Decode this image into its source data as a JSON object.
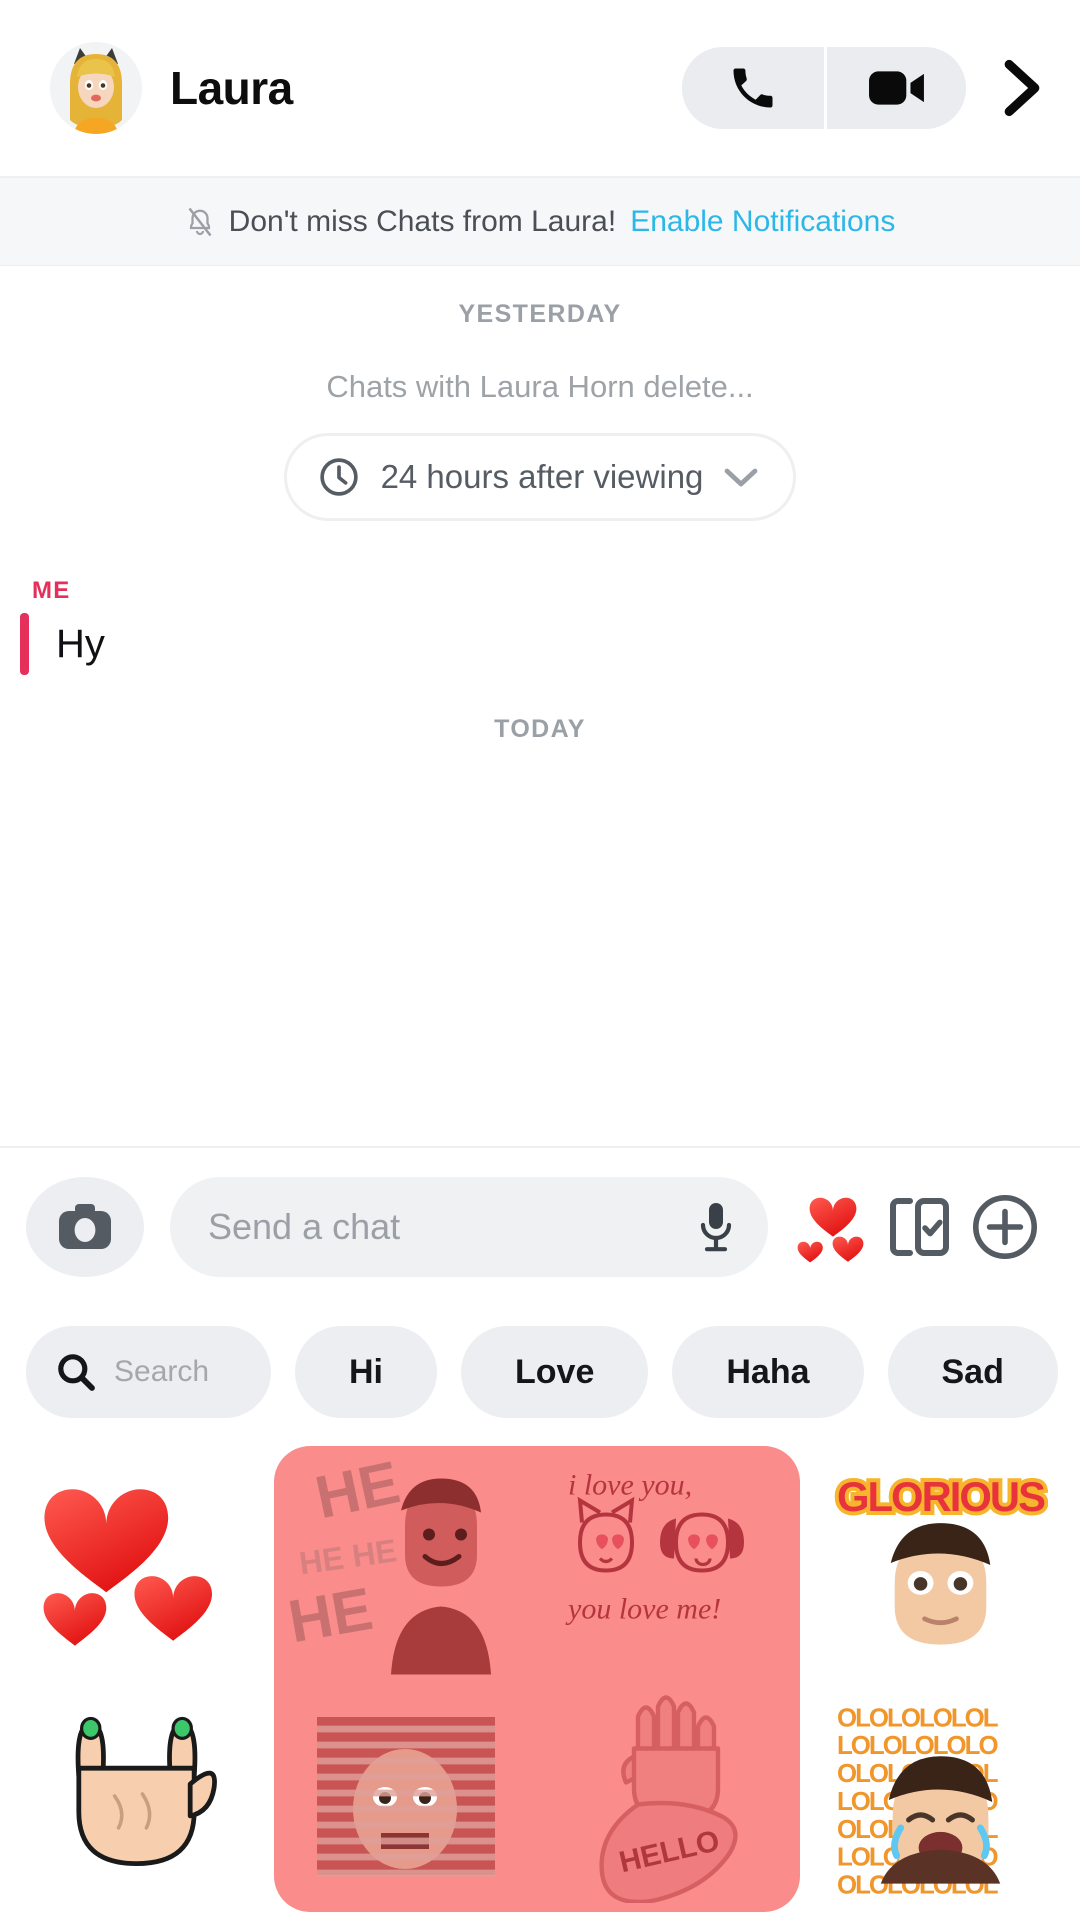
{
  "header": {
    "contact_name": "Laura",
    "avatar_name": "laura-bitmoji-avatar",
    "audio_call_icon": "phone-icon",
    "video_call_icon": "video-camera-icon",
    "forward_icon": "chevron-right-icon"
  },
  "banner": {
    "bell_icon": "bell-muted-icon",
    "message": "Don't miss Chats from Laura!",
    "link": "Enable Notifications",
    "link_color": "#2bb8e8",
    "background": "#f6f7f9"
  },
  "chat": {
    "day_separator_top": "YESTERDAY",
    "system_note": "Chats with Laura Horn delete...",
    "timer": {
      "icon": "clock-icon",
      "label": "24 hours after viewing",
      "chevron": "chevron-down-icon"
    },
    "messages": [
      {
        "sender": "ME",
        "text": "Hy",
        "accent_color": "#e5305c"
      }
    ],
    "day_separator_bottom": "TODAY"
  },
  "input_bar": {
    "camera_icon": "camera-icon",
    "placeholder": "Send a chat",
    "mic_icon": "microphone-icon",
    "hearts_icon": "hearts-emoji-icon",
    "sticker_icon": "sticker-cards-icon",
    "plus_icon": "plus-circle-icon"
  },
  "sticker_panel": {
    "search_icon": "search-icon",
    "search_placeholder": "Search",
    "chips": [
      {
        "label": "Hi"
      },
      {
        "label": "Love"
      },
      {
        "label": "Haha"
      },
      {
        "label": "Sad"
      }
    ],
    "grid": {
      "left_column": [
        {
          "name": "hearts-sticker",
          "type": "emoji-hearts"
        },
        {
          "name": "rock-on-hand-sticker",
          "type": "hand-horns"
        }
      ],
      "featured_pack": {
        "name": "featured-sticker-pack",
        "background_color": "#fa8c8c",
        "tiles": [
          {
            "name": "he-he-he-bitmoji-sticker",
            "caption": "HE HE HE"
          },
          {
            "name": "i-love-you-you-love-me-sticker",
            "caption_top": "i love you,",
            "caption_bottom": "you love me!"
          },
          {
            "name": "peeking-blinds-sticker",
            "caption": ""
          },
          {
            "name": "hello-hand-sticker",
            "caption": "HELLO"
          }
        ]
      },
      "right_column": [
        {
          "name": "glorious-bitmoji-sticker",
          "caption": "GLORIOUS"
        },
        {
          "name": "lol-crying-laugh-bitmoji-sticker",
          "caption": "LOL"
        }
      ]
    }
  },
  "colors": {
    "snap_pink": "#e5305c",
    "link_blue": "#2bb8e8",
    "chip_grey": "#eceef1",
    "pack_pink": "#fa8c8c"
  }
}
